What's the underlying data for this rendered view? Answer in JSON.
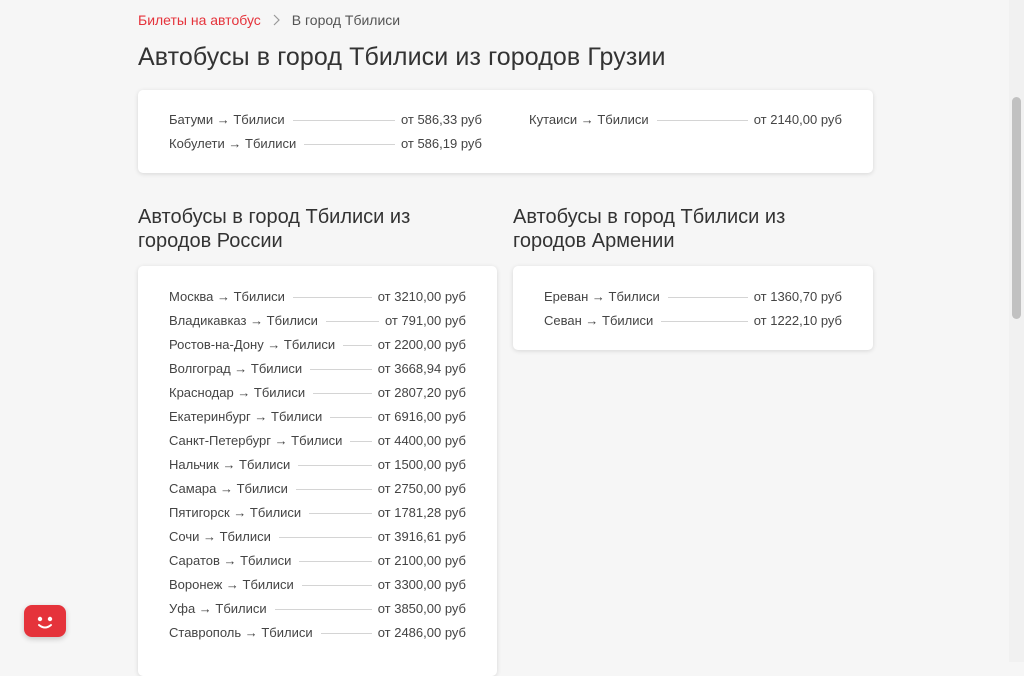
{
  "breadcrumb": {
    "parent": "Билеты на автобус",
    "current": "В город Тбилиси"
  },
  "title": "Автобусы в город Тбилиси из городов Грузии",
  "georgia": {
    "left": [
      {
        "name": "Батуми → Тбилиси",
        "price": "от 586,33 руб"
      },
      {
        "name": "Кобулети → Тбилиси",
        "price": "от 586,19 руб"
      }
    ],
    "right": [
      {
        "name": "Кутаиси → Тбилиси",
        "price": "от 2140,00 руб"
      }
    ]
  },
  "russia": {
    "heading_line1": "Автобусы в город Тбилиси из",
    "heading_line2": "городов России",
    "routes": [
      {
        "name": "Москва → Тбилиси",
        "price": "от 3210,00 руб"
      },
      {
        "name": "Владикавказ → Тбилиси",
        "price": "от 791,00 руб"
      },
      {
        "name": "Ростов-на-Дону → Тбилиси",
        "price": "от 2200,00 руб"
      },
      {
        "name": "Волгоград → Тбилиси",
        "price": "от 3668,94 руб"
      },
      {
        "name": "Краснодар → Тбилиси",
        "price": "от 2807,20 руб"
      },
      {
        "name": "Екатеринбург → Тбилиси",
        "price": "от 6916,00 руб"
      },
      {
        "name": "Санкт-Петербург → Тбилиси",
        "price": "от 4400,00 руб"
      },
      {
        "name": "Нальчик → Тбилиси",
        "price": "от 1500,00 руб"
      },
      {
        "name": "Самара → Тбилиси",
        "price": "от 2750,00 руб"
      },
      {
        "name": "Пятигорск → Тбилиси",
        "price": "от 1781,28 руб"
      },
      {
        "name": "Сочи → Тбилиси",
        "price": "от 3916,61 руб"
      },
      {
        "name": "Саратов → Тбилиси",
        "price": "от 2100,00 руб"
      },
      {
        "name": "Воронеж → Тбилиси",
        "price": "от 3300,00 руб"
      },
      {
        "name": "Уфа → Тбилиси",
        "price": "от 3850,00 руб"
      },
      {
        "name": "Ставрополь → Тбилиси",
        "price": "от 2486,00 руб"
      }
    ]
  },
  "armenia": {
    "heading_line1": "Автобусы в город Тбилиси из",
    "heading_line2": "городов Армении",
    "routes": [
      {
        "name": "Ереван → Тбилиси",
        "price": "от 1360,70 руб"
      },
      {
        "name": "Севан → Тбилиси",
        "price": "от 1222,10 руб"
      }
    ]
  },
  "colors": {
    "accent": "#e5333b",
    "background": "#f6f6f6"
  },
  "icons": {
    "breadcrumb_separator": "chevron-right-icon",
    "chat": "chat-bot-icon"
  }
}
